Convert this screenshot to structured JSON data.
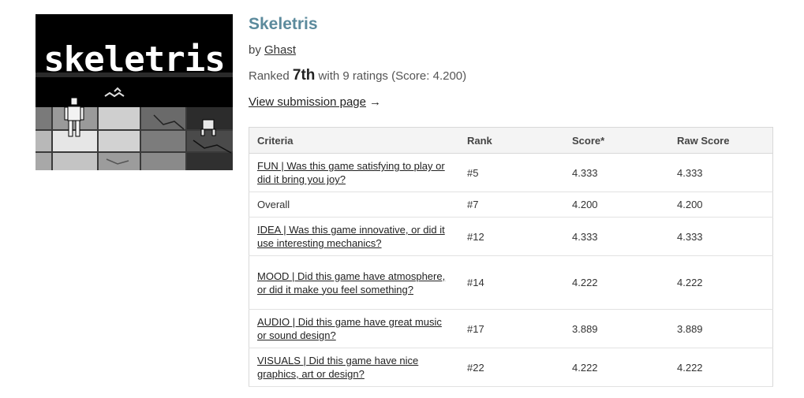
{
  "game": {
    "title": "Skeletris",
    "by_prefix": "by",
    "author": "Ghast",
    "ranked_prefix": "Ranked",
    "place": "7th",
    "ranked_suffix": "with 9 ratings (Score: 4.200)",
    "view_link": "View submission page",
    "view_arrow": "→",
    "thumbnail_text": "skeletris"
  },
  "table": {
    "headers": [
      "Criteria",
      "Rank",
      "Score*",
      "Raw Score"
    ],
    "rows": [
      {
        "criteria": "FUN | Was this game satisfying to play or did it bring you joy?",
        "link": true,
        "rank": "#5",
        "score": "4.333",
        "raw": "4.333"
      },
      {
        "criteria": "Overall",
        "link": false,
        "rank": "#7",
        "score": "4.200",
        "raw": "4.200"
      },
      {
        "criteria": "IDEA | Was this game innovative, or did it use interesting mechanics?",
        "link": true,
        "rank": "#12",
        "score": "4.333",
        "raw": "4.333"
      },
      {
        "criteria": "MOOD | Did this game have atmosphere, or did it make you feel something?",
        "link": true,
        "rank": "#14",
        "score": "4.222",
        "raw": "4.222"
      },
      {
        "criteria": "AUDIO | Did this game have great music or sound design?",
        "link": true,
        "rank": "#17",
        "score": "3.889",
        "raw": "3.889"
      },
      {
        "criteria": "VISUALS | Did this game have nice graphics, art or design?",
        "link": true,
        "rank": "#22",
        "score": "4.222",
        "raw": "4.222"
      }
    ]
  },
  "colors": {
    "title": "#5b8a9c",
    "header_bg": "#f4f4f4",
    "border": "#d8d8d8"
  }
}
